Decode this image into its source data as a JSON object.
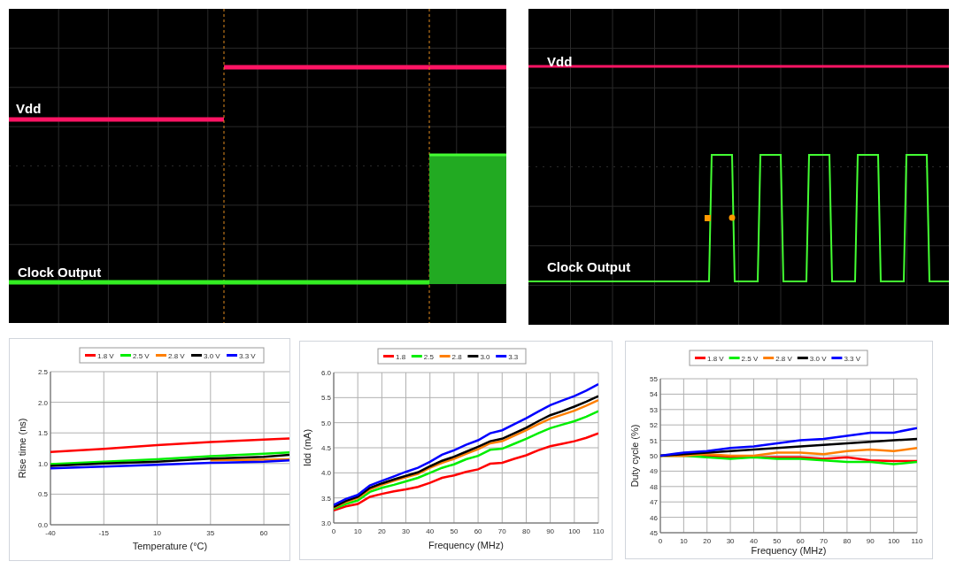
{
  "oscilloscope_captures": [
    {
      "traces": [
        {
          "label": "Vdd"
        },
        {
          "label": "Clock Output"
        }
      ]
    },
    {
      "traces": [
        {
          "label": "Vdd"
        },
        {
          "label": "Clock Output"
        }
      ]
    }
  ],
  "charts": [
    {
      "chart_data": {
        "type": "line",
        "grid": true,
        "legend": true,
        "xlabel": "Temperature (°C)",
        "ylabel": "Rise time (ns)",
        "x": [
          -40,
          -15,
          10,
          35,
          60,
          72
        ],
        "xlim": [
          -40,
          72
        ],
        "ylim": [
          0,
          2.5
        ],
        "xticks": [
          -40,
          -15,
          10,
          35,
          60
        ],
        "yticks": [
          {
            "value": 0,
            "label": "0.0"
          },
          {
            "value": 0.5,
            "label": "0.5"
          },
          {
            "value": 1,
            "label": "1.0"
          },
          {
            "value": 1.5,
            "label": "1.5"
          },
          {
            "value": 2,
            "label": "2.0"
          },
          {
            "value": 2.5,
            "label": "2.5"
          }
        ],
        "series": [
          {
            "name": "1.8 V",
            "color": "#ff0000",
            "values": [
              1.19,
              1.24,
              1.3,
              1.35,
              1.39,
              1.41
            ]
          },
          {
            "name": "2.5 V",
            "color": "#00ee00",
            "values": [
              0.99,
              1.03,
              1.07,
              1.12,
              1.16,
              1.18
            ]
          },
          {
            "name": "2.8 V",
            "color": "#ff7f00",
            "values": [
              null,
              null,
              null,
              1.05,
              1.06,
              1.07
            ]
          },
          {
            "name": "3.0 V",
            "color": "#000000",
            "values": [
              0.96,
              1.0,
              1.03,
              1.08,
              1.11,
              1.14
            ]
          },
          {
            "name": "3.3 V",
            "color": "#0000ff",
            "values": [
              0.92,
              0.95,
              0.98,
              1.01,
              1.03,
              1.05
            ]
          }
        ]
      }
    },
    {
      "chart_data": {
        "type": "line",
        "grid": true,
        "legend": true,
        "xlabel": "Frequency (MHz)",
        "ylabel": "Idd (mA)",
        "x": [
          0,
          5,
          10,
          15,
          20,
          25,
          30,
          35,
          40,
          45,
          50,
          55,
          60,
          65,
          70,
          75,
          80,
          85,
          90,
          95,
          100,
          105,
          110
        ],
        "xlim": [
          0,
          110
        ],
        "ylim": [
          3,
          6
        ],
        "xticks": [
          0,
          10,
          20,
          30,
          40,
          50,
          60,
          70,
          80,
          90,
          100,
          110
        ],
        "yticks": [
          {
            "value": 3,
            "label": "3.0"
          },
          {
            "value": 3.5,
            "label": "3.5"
          },
          {
            "value": 4,
            "label": "4.0"
          },
          {
            "value": 4.5,
            "label": "4.5"
          },
          {
            "value": 5,
            "label": "5.0"
          },
          {
            "value": 5.5,
            "label": "5.5"
          },
          {
            "value": 6,
            "label": "6.0"
          }
        ],
        "series": [
          {
            "name": "1.8",
            "color": "#ff0000",
            "values": [
              3.25,
              3.33,
              3.38,
              3.52,
              3.58,
              3.63,
              3.67,
              3.72,
              3.8,
              3.9,
              3.95,
              4.02,
              4.07,
              4.18,
              4.2,
              4.28,
              4.35,
              4.45,
              4.53,
              4.58,
              4.63,
              4.7,
              4.79
            ]
          },
          {
            "name": "2.5",
            "color": "#00ee00",
            "values": [
              3.28,
              3.38,
              3.45,
              3.62,
              3.7,
              3.76,
              3.83,
              3.9,
              4.0,
              4.1,
              4.17,
              4.27,
              4.34,
              4.46,
              4.48,
              4.58,
              4.68,
              4.79,
              4.89,
              4.96,
              5.03,
              5.12,
              5.23
            ]
          },
          {
            "name": "2.8",
            "color": "#ff7f00",
            "values": [
              3.3,
              3.42,
              3.5,
              3.67,
              3.76,
              3.84,
              3.91,
              3.98,
              4.1,
              4.2,
              4.28,
              4.38,
              4.47,
              4.59,
              4.63,
              4.74,
              4.85,
              4.97,
              5.08,
              5.16,
              5.24,
              5.34,
              5.45
            ]
          },
          {
            "name": "3.0",
            "color": "#000000",
            "values": [
              3.32,
              3.44,
              3.52,
              3.7,
              3.79,
              3.87,
              3.94,
              4.01,
              4.13,
              4.24,
              4.32,
              4.42,
              4.52,
              4.63,
              4.68,
              4.79,
              4.9,
              5.03,
              5.15,
              5.23,
              5.32,
              5.42,
              5.53
            ]
          },
          {
            "name": "3.3",
            "color": "#0000ff",
            "values": [
              3.36,
              3.48,
              3.56,
              3.75,
              3.84,
              3.93,
              4.02,
              4.1,
              4.22,
              4.36,
              4.45,
              4.56,
              4.65,
              4.79,
              4.85,
              4.97,
              5.09,
              5.22,
              5.35,
              5.44,
              5.53,
              5.64,
              5.77
            ]
          }
        ]
      }
    },
    {
      "chart_data": {
        "type": "line",
        "grid": true,
        "legend": true,
        "xlabel": "Frequency (MHz)",
        "ylabel": "Duty cycle (%)",
        "x": [
          0,
          10,
          20,
          30,
          40,
          50,
          60,
          70,
          80,
          90,
          100,
          110
        ],
        "xlim": [
          0,
          110
        ],
        "ylim": [
          45,
          55
        ],
        "xticks": [
          0,
          10,
          20,
          30,
          40,
          50,
          60,
          70,
          80,
          90,
          100,
          110
        ],
        "yticks": [
          45,
          46,
          47,
          48,
          49,
          50,
          51,
          52,
          53,
          54,
          55
        ],
        "series": [
          {
            "name": "1.8 V",
            "color": "#ff0000",
            "values": [
              50,
              50,
              50,
              49.9,
              49.9,
              49.9,
              49.9,
              49.8,
              49.9,
              49.7,
              49.65,
              49.65
            ]
          },
          {
            "name": "2.5 V",
            "color": "#00ee00",
            "values": [
              50,
              50,
              49.9,
              49.8,
              49.9,
              49.8,
              49.8,
              49.7,
              49.6,
              49.6,
              49.45,
              49.6
            ]
          },
          {
            "name": "2.8 V",
            "color": "#ff7f00",
            "values": [
              50,
              50,
              50.1,
              50.0,
              50.0,
              50.2,
              50.2,
              50.1,
              50.3,
              50.4,
              50.3,
              50.5
            ]
          },
          {
            "name": "3.0 V",
            "color": "#000000",
            "values": [
              50,
              50.1,
              50.2,
              50.3,
              50.4,
              50.5,
              50.6,
              50.7,
              50.8,
              50.9,
              51.0,
              51.1
            ]
          },
          {
            "name": "3.3 V",
            "color": "#0000ff",
            "values": [
              50,
              50.2,
              50.3,
              50.5,
              50.6,
              50.8,
              51.0,
              51.1,
              51.3,
              51.5,
              51.5,
              51.8
            ]
          }
        ]
      }
    }
  ]
}
